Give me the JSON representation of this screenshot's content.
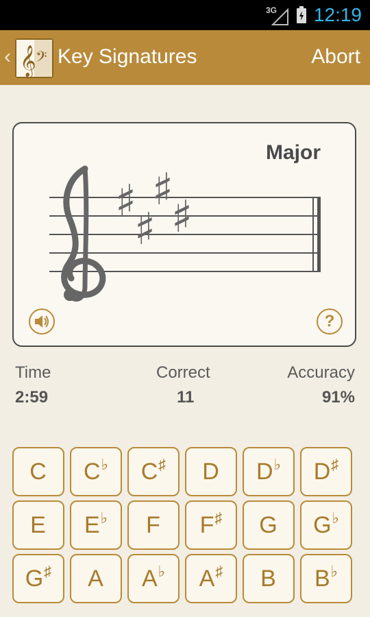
{
  "status_bar": {
    "network": "3G",
    "time": "12:19"
  },
  "action_bar": {
    "title": "Key Signatures",
    "abort_label": "Abort"
  },
  "card": {
    "mode": "Major",
    "help_label": "?"
  },
  "stats": {
    "time_label": "Time",
    "time_value": "2:59",
    "correct_label": "Correct",
    "correct_value": "11",
    "accuracy_label": "Accuracy",
    "accuracy_value": "91%"
  },
  "keys": [
    {
      "note": "C",
      "acc": ""
    },
    {
      "note": "C",
      "acc": "♭"
    },
    {
      "note": "C",
      "acc": "♯"
    },
    {
      "note": "D",
      "acc": ""
    },
    {
      "note": "D",
      "acc": "♭"
    },
    {
      "note": "D",
      "acc": "♯"
    },
    {
      "note": "E",
      "acc": ""
    },
    {
      "note": "E",
      "acc": "♭"
    },
    {
      "note": "F",
      "acc": ""
    },
    {
      "note": "F",
      "acc": "♯"
    },
    {
      "note": "G",
      "acc": ""
    },
    {
      "note": "G",
      "acc": "♭"
    },
    {
      "note": "G",
      "acc": "♯"
    },
    {
      "note": "A",
      "acc": ""
    },
    {
      "note": "A",
      "acc": "♭"
    },
    {
      "note": "A",
      "acc": "♯"
    },
    {
      "note": "B",
      "acc": ""
    },
    {
      "note": "B",
      "acc": "♭"
    }
  ],
  "colors": {
    "accent": "#b88a3a",
    "background": "#f3eee3",
    "status_time": "#35b5e5"
  }
}
